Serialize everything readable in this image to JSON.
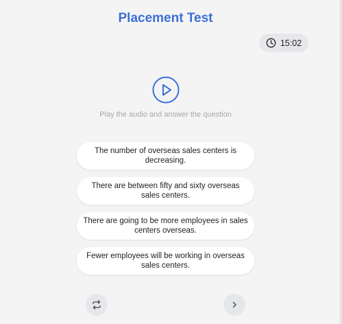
{
  "header": {
    "title": "Placement Test"
  },
  "timer": {
    "icon": "clock-icon",
    "value": "15:02"
  },
  "player": {
    "icon": "play-icon",
    "instruction": "Play the audio and answer the question"
  },
  "options": [
    {
      "text": "The number of overseas sales centers is decreasing."
    },
    {
      "text": "There are between fifty and sixty overseas sales centers."
    },
    {
      "text": "There are going to be more employees in sales centers overseas."
    },
    {
      "text": "Fewer employees will be working in overseas sales centers."
    }
  ],
  "footer": {
    "repeat_icon": "repeat-icon",
    "next_icon": "chevron-right-icon"
  },
  "colors": {
    "accent": "#3b6fd8",
    "background": "#f4f4f4",
    "pill": "#e6e7ea"
  }
}
